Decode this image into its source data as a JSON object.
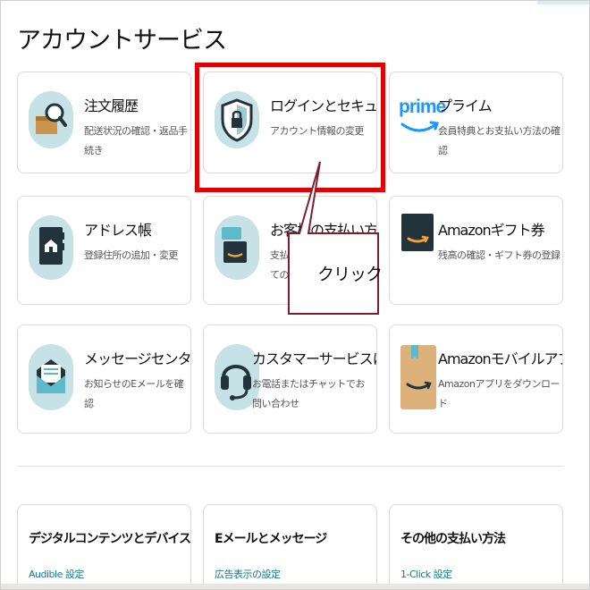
{
  "page": {
    "title": "アカウントサービス"
  },
  "cards": [
    {
      "title": "注文履歴",
      "desc": "配送状況の確認・返品手続き",
      "icon": "order-search-icon"
    },
    {
      "title": "ログインとセキュリティ",
      "desc": "アカウント情報の変更",
      "icon": "shield-lock-icon"
    },
    {
      "title": "プライム",
      "desc": "会員特典とお支払い方法の確認",
      "icon": "prime-logo-icon",
      "logo": "prime"
    },
    {
      "title": "アドレス帳",
      "desc": "登録住所の追加・変更",
      "icon": "address-book-icon"
    },
    {
      "title": "お客様の支払い方法",
      "desc": "支払い方法の管理とすべてのトランザクション",
      "icon": "payment-card-icon"
    },
    {
      "title": "Amazonギフト券",
      "desc": "残高の確認・ギフト券の登録",
      "icon": "gift-card-icon"
    },
    {
      "title": "メッセージセンター",
      "desc": "お知らせのEメールを確認",
      "icon": "mail-envelope-icon"
    },
    {
      "title": "カスタマーサービスに連絡",
      "desc": "お電話またはチャットでお問い合わせ",
      "icon": "headset-icon"
    },
    {
      "title": "Amazonモバイルアプリ",
      "desc": "Amazonアプリをダウンロード",
      "icon": "app-box-icon"
    }
  ],
  "sections": [
    {
      "title": "デジタルコンテンツとデバイス",
      "link": "Audible 設定"
    },
    {
      "title": "Eメールとメッセージ",
      "link": "広告表示の設定"
    },
    {
      "title": "その他の支払い方法",
      "link": "1-Click 設定"
    }
  ],
  "annotation": {
    "label": "クリック"
  },
  "colors": {
    "highlight": "#e00000",
    "circle": "#c6e2e6",
    "link": "#117a8b",
    "callout_border": "#7a1f2b"
  }
}
